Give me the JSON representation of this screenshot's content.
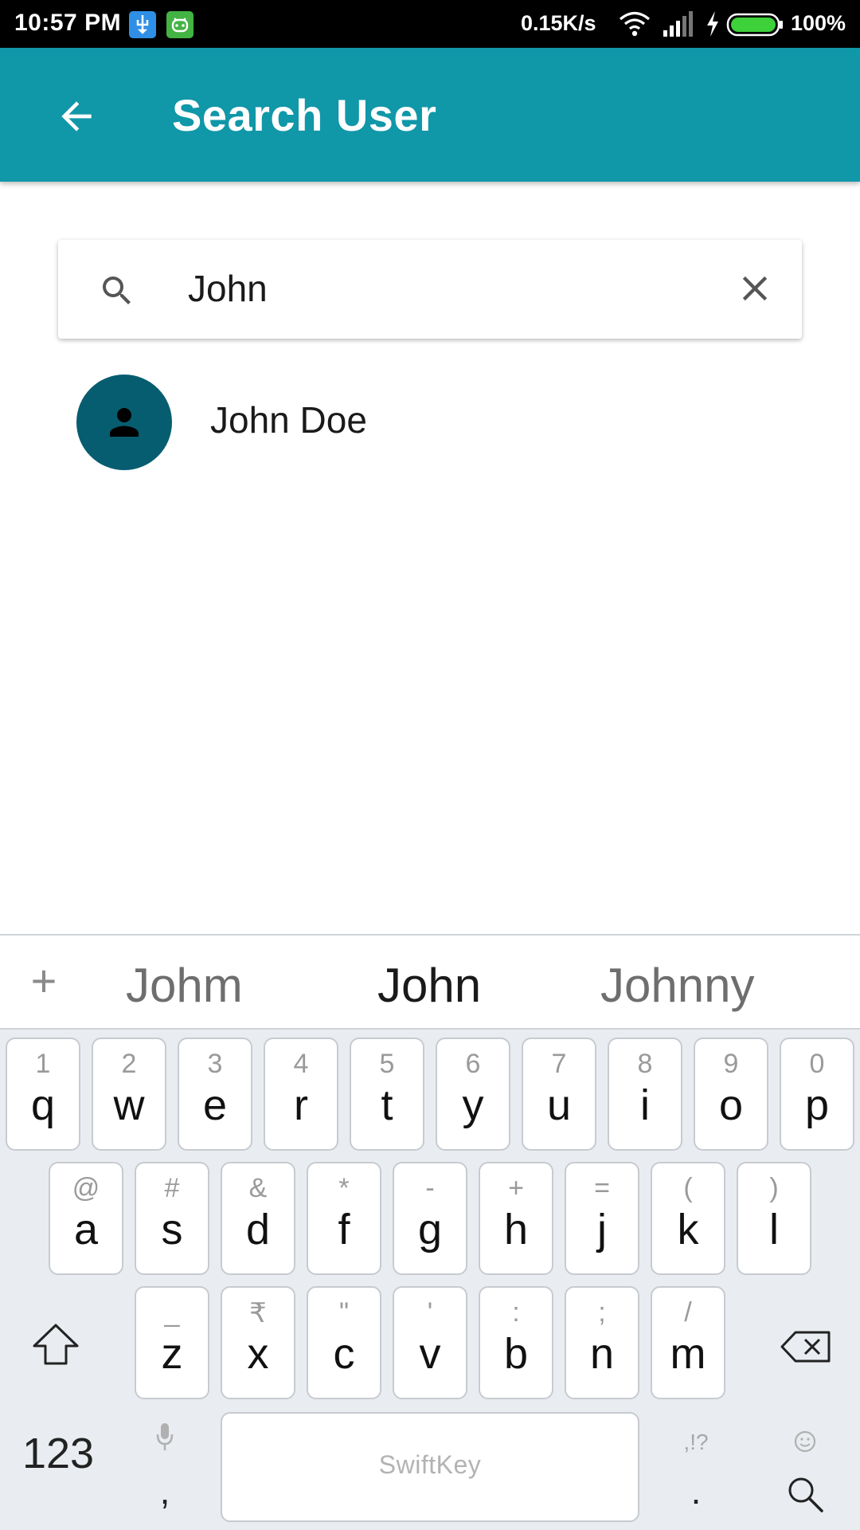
{
  "status_bar": {
    "time": "10:57 PM",
    "net_speed": "0.15K/s",
    "battery": "100%",
    "icons": [
      "usb-icon",
      "android-debug-icon",
      "wifi-icon",
      "signal-icon",
      "charging-icon",
      "battery-icon"
    ]
  },
  "app_bar": {
    "title": "Search User",
    "back_icon": "arrow-back-icon",
    "color": "#1097a8"
  },
  "search": {
    "value": "John",
    "search_icon": "search-icon",
    "clear_icon": "close-icon"
  },
  "results": [
    {
      "name": "John Doe",
      "avatar_icon": "person-icon",
      "avatar_color": "#075d70"
    }
  ],
  "keyboard": {
    "brand": "SwiftKey",
    "suggestions": [
      "Johm",
      "John",
      "Johnny"
    ],
    "plus": "+",
    "row1": [
      {
        "alt": "1",
        "key": "q"
      },
      {
        "alt": "2",
        "key": "w"
      },
      {
        "alt": "3",
        "key": "e"
      },
      {
        "alt": "4",
        "key": "r"
      },
      {
        "alt": "5",
        "key": "t"
      },
      {
        "alt": "6",
        "key": "y"
      },
      {
        "alt": "7",
        "key": "u"
      },
      {
        "alt": "8",
        "key": "i"
      },
      {
        "alt": "9",
        "key": "o"
      },
      {
        "alt": "0",
        "key": "p"
      }
    ],
    "row2": [
      {
        "alt": "@",
        "key": "a"
      },
      {
        "alt": "#",
        "key": "s"
      },
      {
        "alt": "&",
        "key": "d"
      },
      {
        "alt": "*",
        "key": "f"
      },
      {
        "alt": "-",
        "key": "g"
      },
      {
        "alt": "+",
        "key": "h"
      },
      {
        "alt": "=",
        "key": "j"
      },
      {
        "alt": "(",
        "key": "k"
      },
      {
        "alt": ")",
        "key": "l"
      }
    ],
    "row3": [
      {
        "alt": "_",
        "key": "z"
      },
      {
        "alt": "₹",
        "key": "x"
      },
      {
        "alt": "\"",
        "key": "c"
      },
      {
        "alt": "'",
        "key": "v"
      },
      {
        "alt": ":",
        "key": "b"
      },
      {
        "alt": ";",
        "key": "n"
      },
      {
        "alt": "/",
        "key": "m"
      }
    ],
    "num_label": "123",
    "comma": ",",
    "period": ".",
    "period_alt": ",!?"
  }
}
